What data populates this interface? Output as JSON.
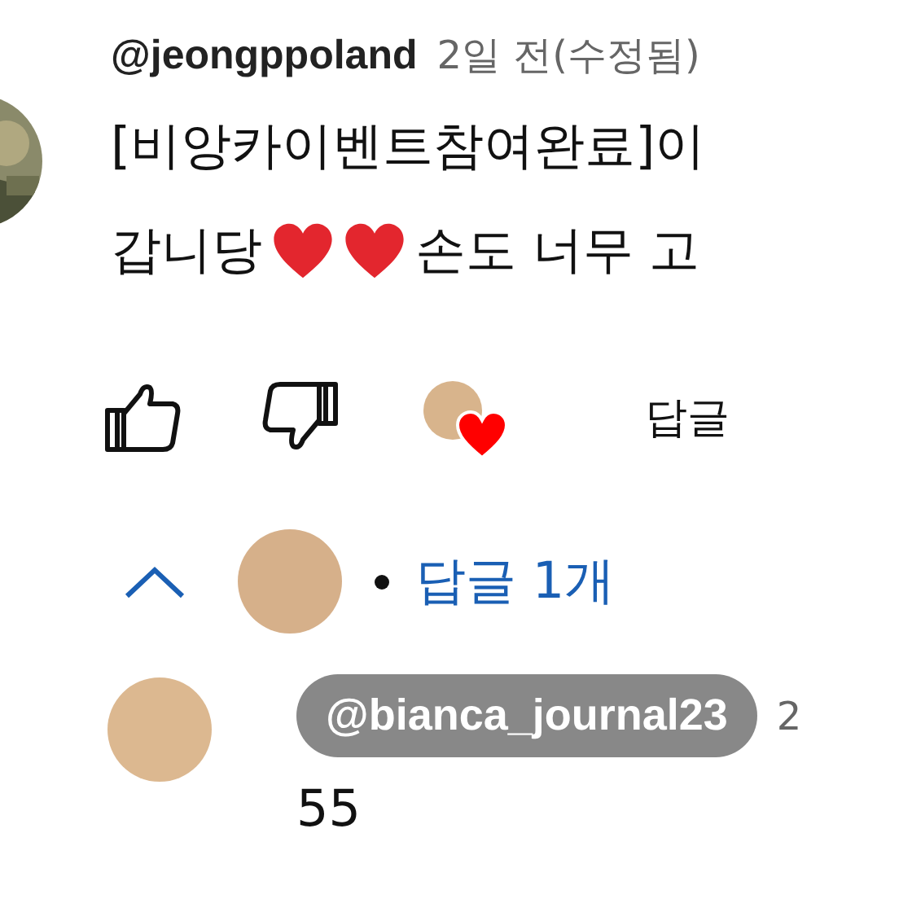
{
  "comment": {
    "author": "@jeongppoland",
    "time": "2일 전(수정됨)",
    "lines": [
      [
        {
          "kind": "text",
          "text": "[비앙카이벤트참여완료]이"
        }
      ],
      [
        {
          "kind": "text",
          "text": "갑니당"
        },
        {
          "kind": "heart"
        },
        {
          "kind": "heart"
        },
        {
          "kind": "text",
          "text": "손도 너무 고"
        }
      ]
    ],
    "hearted_by_creator": true,
    "reply_label": "답글"
  },
  "replies": {
    "expanded": true,
    "count_label": "답글 1개"
  },
  "reply": {
    "author": "@bianca_journal23",
    "author_highlighted": true,
    "time": "2",
    "text": "55"
  }
}
